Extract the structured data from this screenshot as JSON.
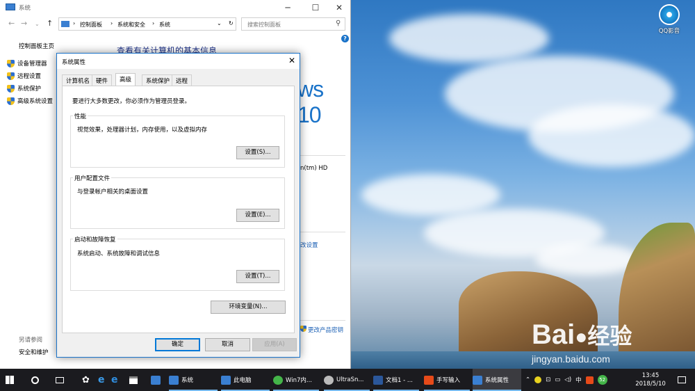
{
  "desktop": {
    "shortcut_label": "QQ影音",
    "watermark_brand": "Bai",
    "watermark_suffix": "经验",
    "watermark_url": "jingyan.baidu.com"
  },
  "system_window": {
    "title": "系统",
    "breadcrumb": [
      "控制面板",
      "系统和安全",
      "系统"
    ],
    "search_placeholder": "搜索控制面板",
    "sidebar_home": "控制面板主页",
    "sidebar_items": [
      "设备管理器",
      "远程设置",
      "系统保护",
      "高级系统设置"
    ],
    "see_also_title": "另请参阅",
    "see_also_items": [
      "安全和维护"
    ],
    "heading": "查看有关计算机的基本信息",
    "edition_fragment": "ws 10",
    "processor_fragment": "n(tm) HD",
    "change_settings_fragment": "改设置",
    "product_key_fragment": "更改产品密钥"
  },
  "dialog": {
    "title": "系统属性",
    "tabs": [
      "计算机名",
      "硬件",
      "高级",
      "系统保护",
      "远程"
    ],
    "active_tab": "高级",
    "admin_note": "要进行大多数更改，你必须作为管理员登录。",
    "groups": [
      {
        "title": "性能",
        "desc": "视觉效果，处理器计划，内存使用，以及虚拟内存",
        "button": "设置(S)..."
      },
      {
        "title": "用户配置文件",
        "desc": "与登录帐户相关的桌面设置",
        "button": "设置(E)..."
      },
      {
        "title": "启动和故障恢复",
        "desc": "系统启动、系统故障和调试信息",
        "button": "设置(T)..."
      }
    ],
    "env_button": "环境变量(N)...",
    "ok_button": "确定",
    "cancel_button": "取消",
    "apply_button": "应用(A)"
  },
  "taskbar": {
    "items": [
      {
        "label": "系统",
        "color": "#3a7fd1"
      },
      {
        "label": "此电脑",
        "color": "#3a7fd1"
      },
      {
        "label": "Win7内...",
        "color": "#44b549"
      },
      {
        "label": "UltraSn...",
        "color": "#bbbbbb"
      },
      {
        "label": "文档1 - ...",
        "color": "#2b579a"
      },
      {
        "label": "手写输入",
        "color": "#e64a19"
      },
      {
        "label": "系统属性",
        "color": "#3a7fd1"
      }
    ],
    "ime": "中",
    "badge": "52",
    "time": "13:45",
    "date": "2018/5/10"
  }
}
